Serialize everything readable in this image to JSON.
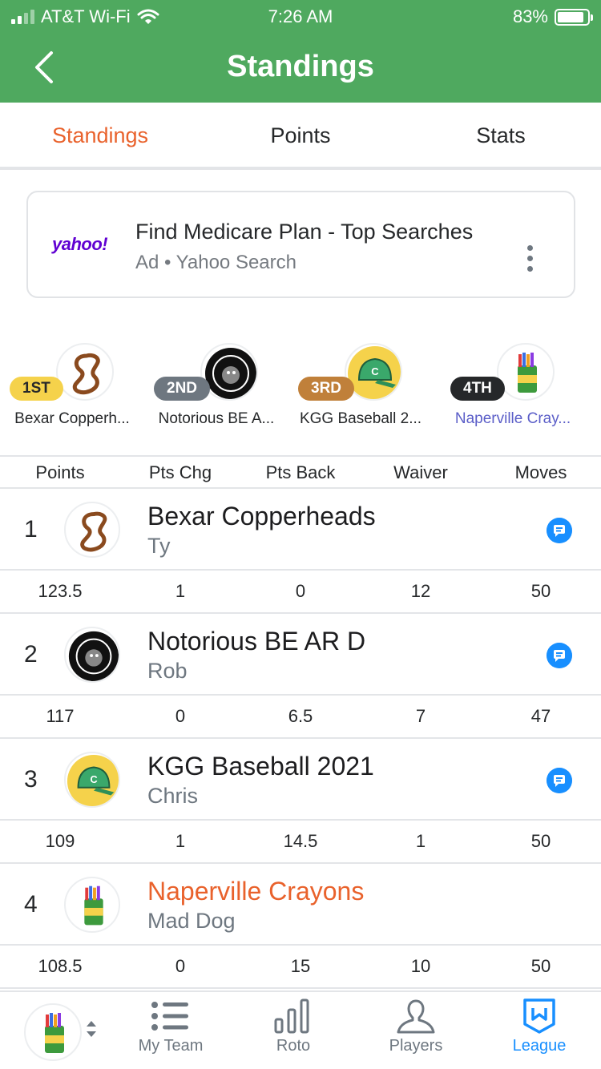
{
  "status": {
    "carrier": "AT&T Wi-Fi",
    "time": "7:26 AM",
    "battery": "83%"
  },
  "header": {
    "title": "Standings"
  },
  "tabs": [
    {
      "label": "Standings",
      "active": true
    },
    {
      "label": "Points",
      "active": false
    },
    {
      "label": "Stats",
      "active": false
    }
  ],
  "ad": {
    "logo": "yahoo!",
    "title": "Find Medicare Plan - Top Searches",
    "sub": "Ad • Yahoo Search"
  },
  "podium": [
    {
      "rank": "1ST",
      "name": "Bexar Copperh...",
      "badge_bg": "#f5d24b",
      "badge_fg": "#26282a"
    },
    {
      "rank": "2ND",
      "name": "Notorious BE A...",
      "badge_bg": "#6e7780",
      "badge_fg": "#ffffff"
    },
    {
      "rank": "3RD",
      "name": "KGG Baseball 2...",
      "badge_bg": "#c0803a",
      "badge_fg": "#ffffff"
    },
    {
      "rank": "4TH",
      "name": "Naperville Cray...",
      "badge_bg": "#26282a",
      "badge_fg": "#ffffff"
    }
  ],
  "columns": [
    "Points",
    "Pts Chg",
    "Pts Back",
    "Waiver",
    "Moves"
  ],
  "rows": [
    {
      "num": "1",
      "name": "Bexar Copperheads",
      "owner": "Ty",
      "stats": [
        "123.5",
        "1",
        "0",
        "12",
        "50"
      ]
    },
    {
      "num": "2",
      "name": "Notorious BE AR D",
      "owner": "Rob",
      "stats": [
        "117",
        "0",
        "6.5",
        "7",
        "47"
      ]
    },
    {
      "num": "3",
      "name": "KGG Baseball 2021",
      "owner": "Chris",
      "stats": [
        "109",
        "1",
        "14.5",
        "1",
        "50"
      ]
    },
    {
      "num": "4",
      "name": "Naperville Crayons",
      "owner": "Mad Dog",
      "stats": [
        "108.5",
        "0",
        "15",
        "10",
        "50"
      ]
    }
  ],
  "bottom_nav": [
    {
      "label": "My Team",
      "icon": "list-icon",
      "active": false
    },
    {
      "label": "Roto",
      "icon": "bar-chart-icon",
      "active": false
    },
    {
      "label": "Players",
      "icon": "person-icon",
      "active": false
    },
    {
      "label": "League",
      "icon": "league-icon",
      "active": true
    }
  ],
  "colors": {
    "header": "#4fa95f",
    "accent": "#e9622c",
    "active_nav": "#188fff",
    "my_team_link": "#5b5ec8"
  }
}
